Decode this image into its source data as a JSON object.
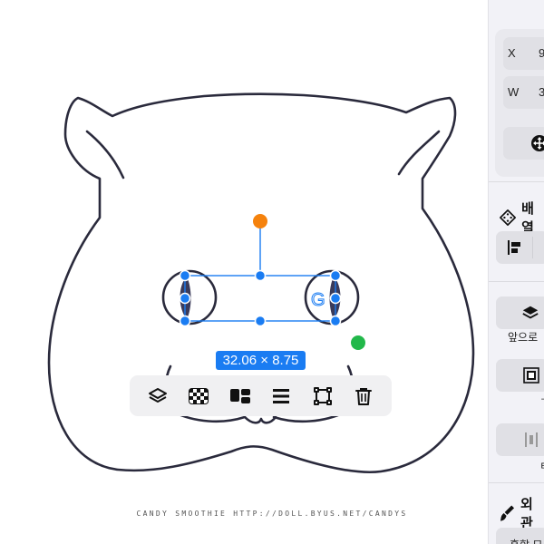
{
  "canvas": {
    "dimension_label": "32.06 × 8.75",
    "credit_text": "candy smoothie http://doll.byus.net/candys",
    "toolbar": [
      {
        "name": "layers-icon"
      },
      {
        "name": "transparency-checker-icon"
      },
      {
        "name": "arrange-blocks-icon"
      },
      {
        "name": "align-lines-icon"
      },
      {
        "name": "crop-transform-icon"
      },
      {
        "name": "trash-icon"
      }
    ]
  },
  "panel": {
    "x_key": "X",
    "x_value": "9",
    "w_key": "W",
    "w_value": "3",
    "arrange_title": "배열",
    "bring_forward_label": "앞으로",
    "small_char": "ㄱ",
    "small_char_2": "ㅌ",
    "appearance_title": "외관",
    "bottom_text": "혼합 모"
  },
  "colors": {
    "accent": "#1a7cf2",
    "rotation_handle": "#f5820d",
    "pivot": "#22b84a",
    "outline": "#2a2a3c"
  }
}
